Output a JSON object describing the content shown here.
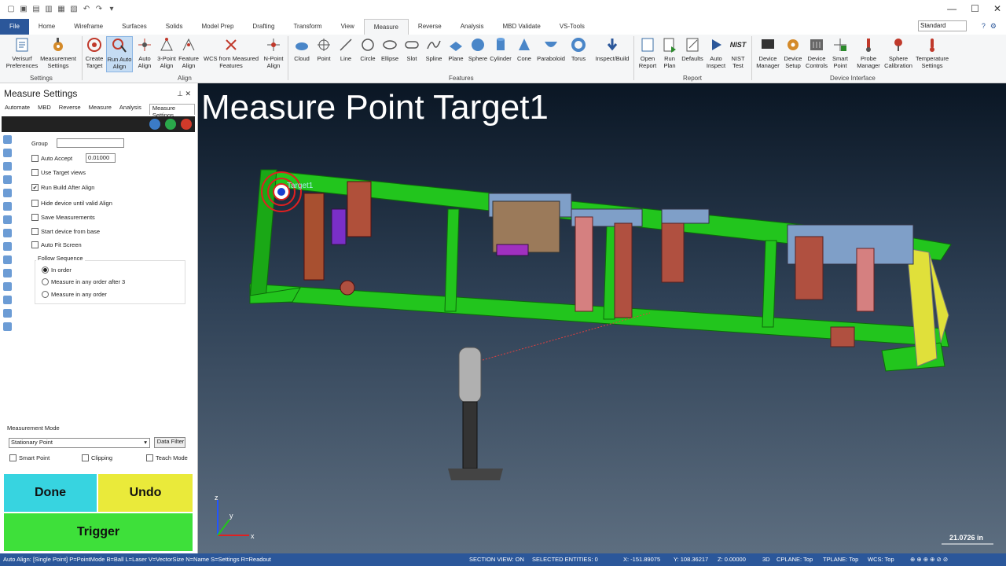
{
  "tabs": [
    "File",
    "Home",
    "Wireframe",
    "Surfaces",
    "Solids",
    "Model Prep",
    "Drafting",
    "Transform",
    "View",
    "Measure",
    "Reverse",
    "Analysis",
    "MBD Validate",
    "VS-Tools"
  ],
  "style_select": "Standard",
  "ribbon": {
    "settings": [
      "Verisurf Preferences",
      "Measurement Settings"
    ],
    "align": [
      "Create Target",
      "Run Auto Align",
      "Auto Align",
      "3-Point Align",
      "Feature Align",
      "WCS from Measured Features",
      "N-Point Align"
    ],
    "features": [
      "Cloud",
      "Point",
      "Line",
      "Circle",
      "Ellipse",
      "Slot",
      "Spline",
      "Plane",
      "Sphere",
      "Cylinder",
      "Cone",
      "Paraboloid",
      "Torus",
      "Inspect/Build"
    ],
    "report": [
      "Open Report",
      "Run Plan",
      "Defaults",
      "Auto Inspect",
      "NIST Test"
    ],
    "device": [
      "Device Manager",
      "Device Setup",
      "Device Controls",
      "Smart Point",
      "Probe Manager",
      "Sphere Calibration",
      "Temperature Settings"
    ],
    "groups": {
      "settings": "Settings",
      "align": "Align",
      "features": "Features",
      "report": "Report",
      "device": "Device Interface"
    }
  },
  "panel": {
    "title": "Measure Settings",
    "tabs": [
      "Automate",
      "MBD",
      "Reverse",
      "Measure",
      "Analysis",
      "Measure Settings"
    ],
    "group_label": "Group",
    "auto_accept_label": "Auto Accept",
    "auto_accept_value": "0.01000",
    "use_target_views": "Use Target views",
    "run_build_after_align": "Run Build After Align",
    "hide_device": "Hide device until valid Align",
    "save_measurements": "Save Measurements",
    "start_device": "Start device from base",
    "auto_fit": "Auto Fit Screen",
    "follow_sequence": "Follow Sequence",
    "seq_in_order": "In order",
    "seq_any_after": "Measure in any order after 3",
    "seq_any": "Measure in any order",
    "measurement_mode_label": "Measurement Mode",
    "mode_value": "Stationary Point",
    "data_filter": "Data Filter",
    "smart_point": "Smart Point",
    "clipping": "Clipping",
    "teach_mode": "Teach Mode",
    "done": "Done",
    "undo": "Undo",
    "trigger": "Trigger"
  },
  "viewport": {
    "title": "Measure Point Target1",
    "target_label": "Target1",
    "scale": "21.0726 in",
    "axis_z": "z",
    "axis_y": "y",
    "axis_x": "x"
  },
  "status": {
    "hint": "Auto Align: [Single Point]  P=PointMode  B=Ball  L=Laser  V=VectorSize  N=Name  S=Settings  R=Readout",
    "section": "SECTION VIEW: ON",
    "selected": "SELECTED ENTITIES: 0",
    "x": "X:  -151.89075",
    "y": "Y:  108.36217",
    "z": "Z:  0.00000",
    "mode3d": "3D",
    "cplane": "CPLANE: Top",
    "tplane": "TPLANE: Top",
    "wcs": "WCS: Top"
  },
  "colors": {
    "accent": "#2b579a",
    "done": "#37d4e0",
    "undo": "#eaea3a",
    "trigger": "#3ee03a",
    "fixture": "#22c51d"
  }
}
